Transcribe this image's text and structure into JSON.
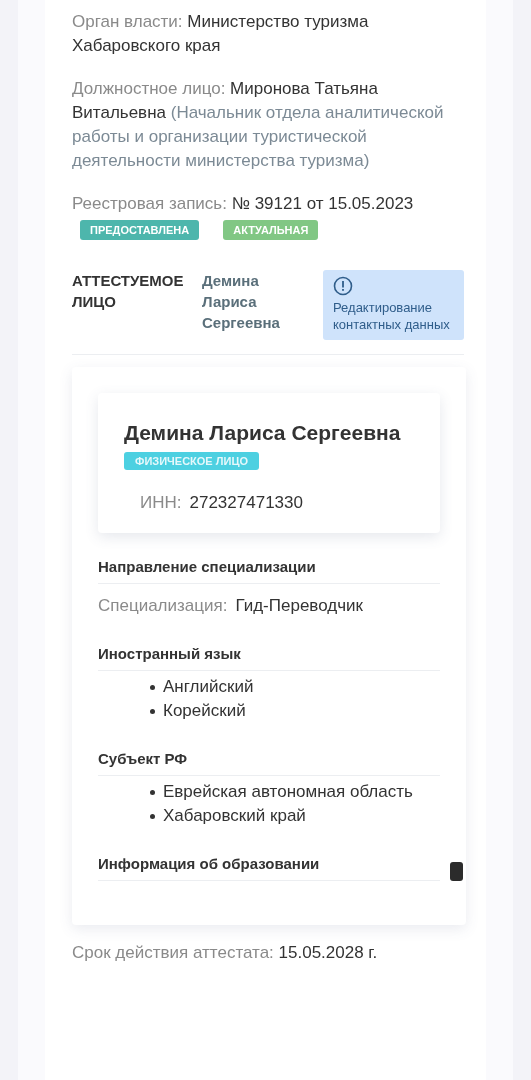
{
  "authority": {
    "label": "Орган власти:",
    "value": "Министерство туризма Хабаровского края"
  },
  "official": {
    "label": "Должностное лицо:",
    "name": "Миронова Татьяна Витальевна",
    "position": "(Начальник отдела аналитической работы и организации туристической деятельности министерства туризма)"
  },
  "registry": {
    "label": "Реестровая запись:",
    "value": "№ 39121 от 15.05.2023",
    "badges": [
      {
        "text": "ПРЕДОСТАВЛЕНА",
        "color": "#4db6ac"
      },
      {
        "text": "АКТУАЛЬНАЯ",
        "color": "#81c784"
      }
    ]
  },
  "attested": {
    "label": "АТТЕСТУЕМОЕ ЛИЦО",
    "name": "Демина Лариса Сергеевна",
    "alert": "Редактирование контактных данных"
  },
  "person_card": {
    "name": "Демина Лариса Сергеевна",
    "type_badge": "ФИЗИЧЕСКОЕ ЛИЦО",
    "inn_label": "ИНН:",
    "inn_value": "272327471330"
  },
  "sections": [
    {
      "title": "Направление специализации",
      "kind": "field",
      "label": "Специализация:",
      "value": "Гид-Переводчик"
    },
    {
      "title": "Иностранный язык",
      "kind": "list",
      "items": [
        "Английский",
        "Корейский"
      ]
    },
    {
      "title": "Субъект РФ",
      "kind": "list",
      "items": [
        "Еврейская автономная область",
        "Хабаровский край"
      ]
    },
    {
      "title": "Информация об образовании",
      "kind": "empty"
    }
  ],
  "validity": {
    "label": "Срок действия аттестата:",
    "value": "15.05.2028 г."
  }
}
